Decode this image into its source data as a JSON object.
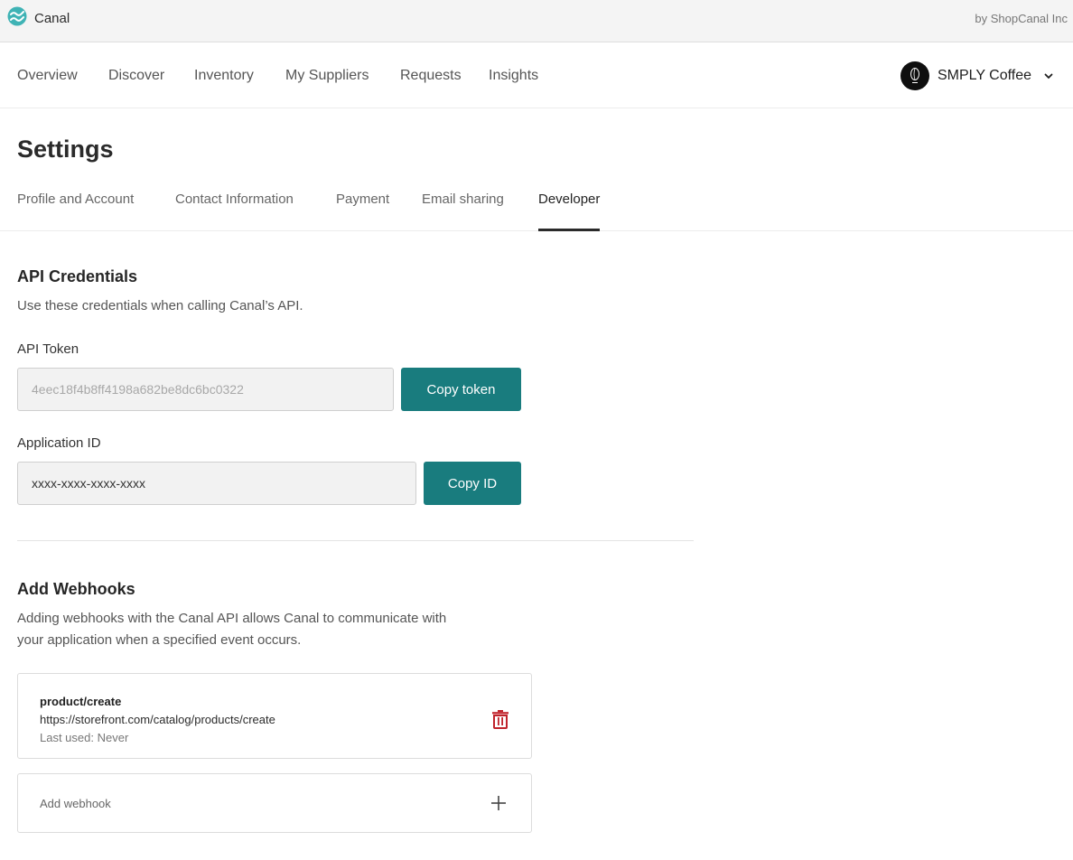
{
  "topbar": {
    "brand": "Canal",
    "byline": "by ShopCanal Inc",
    "brand_color": "#3fb3b5"
  },
  "nav": {
    "items": [
      {
        "label": "Overview"
      },
      {
        "label": "Discover"
      },
      {
        "label": "Inventory"
      },
      {
        "label": "My Suppliers"
      },
      {
        "label": "Requests"
      },
      {
        "label": "Insights"
      }
    ],
    "store_name": "SMPLY Coffee"
  },
  "settings": {
    "title": "Settings",
    "tabs": [
      {
        "label": "Profile and Account"
      },
      {
        "label": "Contact Information"
      },
      {
        "label": "Payment"
      },
      {
        "label": "Email sharing"
      },
      {
        "label": "Developer",
        "active": true
      }
    ]
  },
  "api_credentials": {
    "title": "API Credentials",
    "description": "Use these credentials when calling Canal’s API.",
    "token_label": "API Token",
    "token_value": "4eec18f4b8ff4198a682be8dc6bc0322",
    "copy_token_label": "Copy token",
    "app_id_label": "Application ID",
    "app_id_value": "xxxx-xxxx-xxxx-xxxx",
    "copy_id_label": "Copy ID",
    "button_color": "#197c7e"
  },
  "webhooks": {
    "title": "Add Webhooks",
    "description_line1": "Adding webhooks with the Canal API allows Canal to communicate with",
    "description_line2": "your application when a specified event occurs.",
    "items": [
      {
        "event": "product/create",
        "url": "https://storefront.com/catalog/products/create",
        "last_used": "Last used: Never"
      }
    ],
    "add_label": "Add webhook",
    "delete_color": "#c0232b"
  }
}
